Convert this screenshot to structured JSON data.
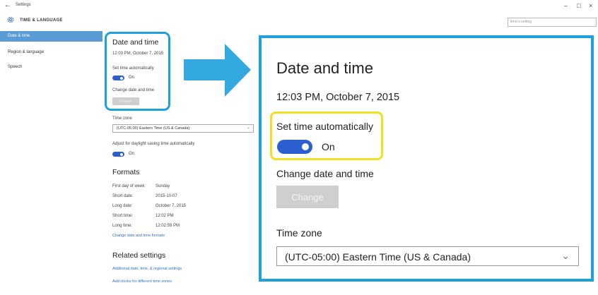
{
  "window": {
    "title": "Settings",
    "controls": {
      "minimize": "–",
      "maximize": "□",
      "close": "×"
    }
  },
  "header": {
    "section_title": "TIME & LANGUAGE",
    "search_placeholder": "Find a setting"
  },
  "sidebar": {
    "items": [
      {
        "label": "Date & time",
        "active": true
      },
      {
        "label": "Region & language",
        "active": false
      },
      {
        "label": "Speech",
        "active": false
      }
    ]
  },
  "content": {
    "title": "Date and time",
    "current_time": "12:03 PM, October 7, 2015",
    "set_time_auto_label": "Set time automatically",
    "set_time_auto_state": "On",
    "change_label": "Change date and time",
    "change_button": "Change",
    "timezone_label": "Time zone",
    "timezone_value": "(UTC-05:00) Eastern Time (US & Canada)",
    "dst_label": "Adjust for daylight saving time automatically",
    "dst_state": "On",
    "formats": {
      "title": "Formats",
      "rows": [
        {
          "label": "First day of week:",
          "value": "Sunday"
        },
        {
          "label": "Short date:",
          "value": "2015-10-07"
        },
        {
          "label": "Long date:",
          "value": "October 7, 2015"
        },
        {
          "label": "Short time:",
          "value": "12:02 PM"
        },
        {
          "label": "Long time:",
          "value": "12:02:59 PM"
        }
      ],
      "link": "Change date and time formats"
    },
    "related": {
      "title": "Related settings",
      "links": [
        "Additional date, time, & regional settings",
        "Add clocks for different time zones"
      ]
    }
  },
  "zoom": {
    "title": "Date and time",
    "current_time": "12:03 PM, October 7, 2015",
    "set_time_auto_label": "Set time automatically",
    "set_time_auto_state": "On",
    "change_label": "Change date and time",
    "change_button": "Change",
    "timezone_label": "Time zone",
    "timezone_value": "(UTC-05:00) Eastern Time (US & Canada)"
  },
  "colors": {
    "accent": "#5b9bd5",
    "toggle_on": "#2b5fd0",
    "callout_blue": "#1ea0dc",
    "callout_yellow": "#f0e020",
    "link": "#2b72c8"
  },
  "icons": [
    "back-arrow-icon",
    "gear-icon",
    "search-icon",
    "chevron-down-icon",
    "right-arrow-icon"
  ]
}
